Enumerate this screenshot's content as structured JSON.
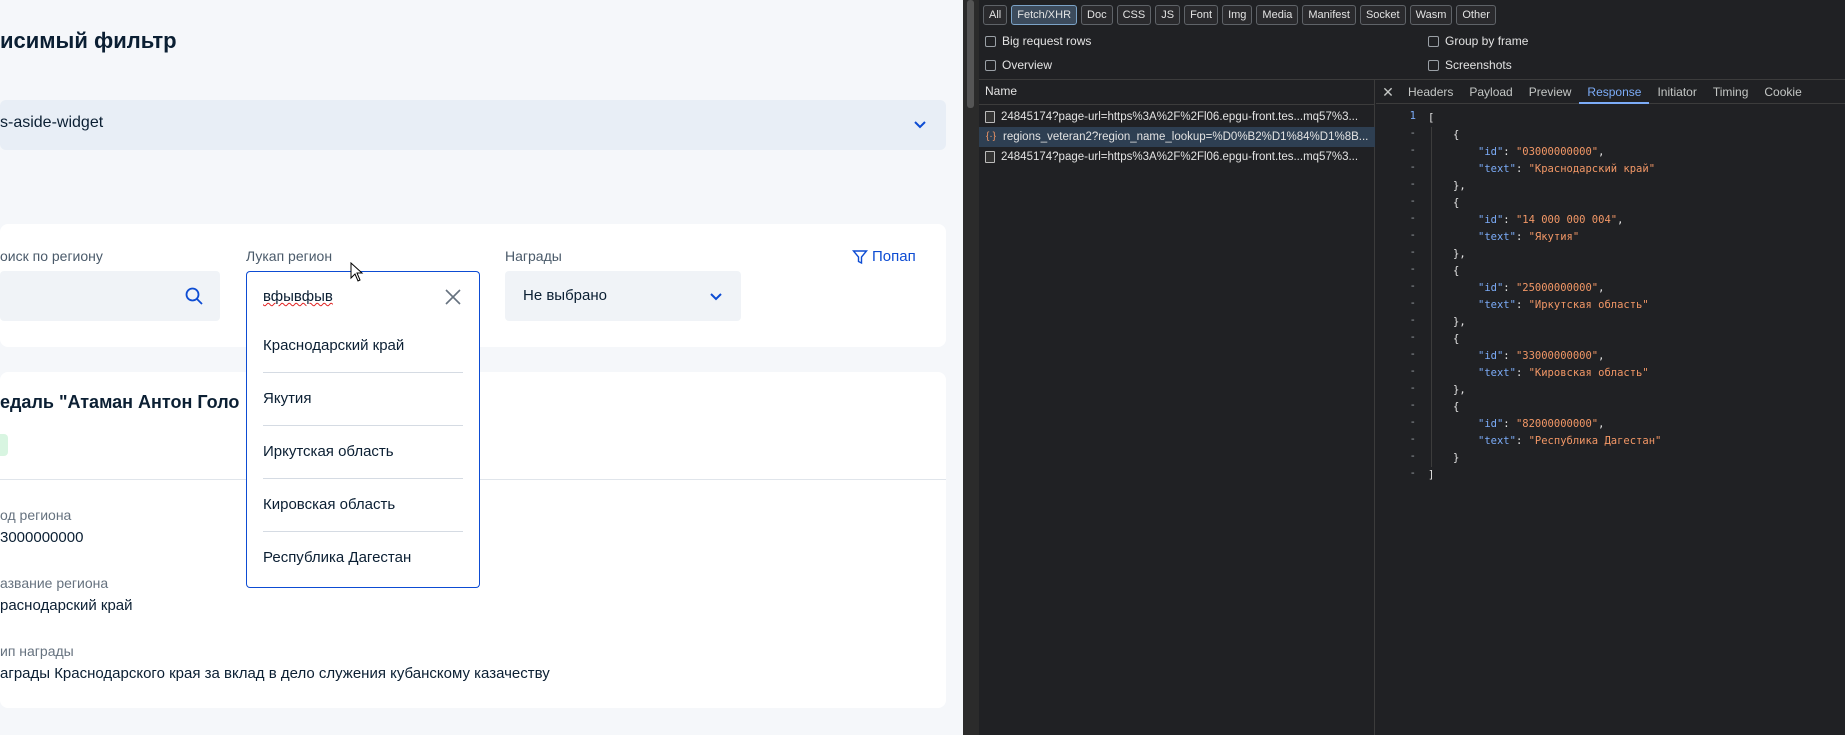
{
  "page": {
    "title": "исимый фильтр",
    "widget_select_value": "s-aside-widget",
    "filters": {
      "region_search_label": "оиск по региону",
      "lookup_label": "Лукап регион",
      "lookup_value": "вфывфыв",
      "awards_label": "Награды",
      "awards_value": "Не выбрано",
      "popap_label": "Попап"
    },
    "dropdown_options": [
      "Краснодарский край",
      "Якутия",
      "Иркутская область",
      "Кировская область",
      "Республика Дагестан"
    ],
    "result": {
      "title": "едаль \"Атаман Антон Голо",
      "fields": [
        {
          "label": "од региона",
          "value": "3000000000"
        },
        {
          "label": "азвание региона",
          "value": "раснодарский край"
        },
        {
          "label": "ип награды",
          "value": "аграды Краснодарского края за вклад в дело служения кубанскому казачеству"
        }
      ]
    }
  },
  "devtools": {
    "filter_chips": [
      "All",
      "Fetch/XHR",
      "Doc",
      "CSS",
      "JS",
      "Font",
      "Img",
      "Media",
      "Manifest",
      "Socket",
      "Wasm",
      "Other"
    ],
    "active_chip": "Fetch/XHR",
    "options": {
      "big_request_rows": "Big request rows",
      "group_by_frame": "Group by frame",
      "overview": "Overview",
      "screenshots": "Screenshots"
    },
    "name_header": "Name",
    "requests": [
      "24845174?page-url=https%3A%2F%2Fl06.epgu-front.tes...mq57%3...",
      "regions_veteran2?region_name_lookup=%D0%B2%D1%84%D1%8B...",
      "24845174?page-url=https%3A%2F%2Fl06.epgu-front.tes...mq57%3..."
    ],
    "tabs": [
      "Headers",
      "Payload",
      "Preview",
      "Response",
      "Initiator",
      "Timing",
      "Cookie"
    ],
    "active_tab": "Response",
    "close_glyph": "✕",
    "line_number": "1",
    "response": [
      {
        "id": "03000000000",
        "text": "Краснодарский край"
      },
      {
        "id": "14 000 000 004",
        "text": "Якутия"
      },
      {
        "id": "25000000000",
        "text": "Иркутская область"
      },
      {
        "id": "33000000000",
        "text": "Кировская область"
      },
      {
        "id": "82000000000",
        "text": "Республика Дагестан"
      }
    ]
  }
}
